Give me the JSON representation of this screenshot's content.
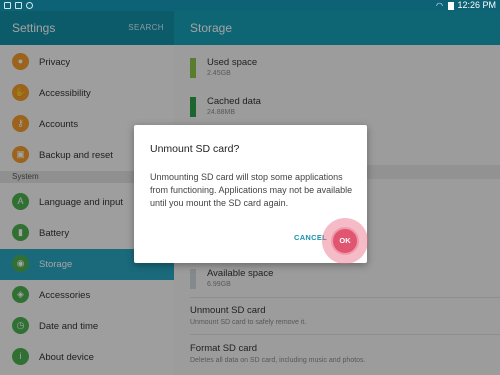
{
  "status_bar": {
    "time": "12:26 PM",
    "icons": [
      "mail-icon",
      "gallery-icon",
      "dropbox-icon",
      "wifi-icon",
      "battery-icon"
    ]
  },
  "left_panel": {
    "title": "Settings",
    "search_label": "SEARCH",
    "section_header": "System",
    "items": [
      {
        "label": "Privacy",
        "icon": "privacy-icon",
        "color": "#f29b2d"
      },
      {
        "label": "Accessibility",
        "icon": "accessibility-icon",
        "color": "#f29b2d"
      },
      {
        "label": "Accounts",
        "icon": "accounts-icon",
        "color": "#f29b2d"
      },
      {
        "label": "Backup and reset",
        "icon": "backup-icon",
        "color": "#f29b2d"
      },
      {
        "label": "Language and input",
        "icon": "language-icon",
        "color": "#4caf50"
      },
      {
        "label": "Battery",
        "icon": "battery-icon",
        "color": "#4caf50"
      },
      {
        "label": "Storage",
        "icon": "storage-icon",
        "color": "#4caf50",
        "selected": true
      },
      {
        "label": "Accessories",
        "icon": "accessories-icon",
        "color": "#4caf50"
      },
      {
        "label": "Date and time",
        "icon": "date-time-icon",
        "color": "#4caf50"
      },
      {
        "label": "About device",
        "icon": "about-icon",
        "color": "#4caf50"
      }
    ]
  },
  "right_panel": {
    "title": "Storage",
    "storage_items": [
      {
        "label": "Used space",
        "value": "2.45GB",
        "color": "#8bc34a"
      },
      {
        "label": "Cached data",
        "value": "24.88MB",
        "color": "#2e9e4a"
      },
      {
        "label": "Available space",
        "value": "6.99GB",
        "color": "#cfd8dc"
      }
    ],
    "actions": [
      {
        "title": "Unmount SD card",
        "description": "Unmount SD card to safely remove it."
      },
      {
        "title": "Format SD card",
        "description": "Deletes all data on SD card, including music and photos."
      }
    ]
  },
  "dialog": {
    "title": "Unmount SD card?",
    "message": "Unmounting SD card will stop some applications from functioning. Applications may not be available until you mount the SD card again.",
    "cancel_label": "CANCEL",
    "ok_label": "OK"
  },
  "colors": {
    "status_bar": "#0d6275",
    "left_appbar": "#148fa7",
    "right_appbar": "#17a0b8",
    "selected_item": "#2aa7c2",
    "accent": "#1795b0",
    "ok_button": "#e05570"
  }
}
